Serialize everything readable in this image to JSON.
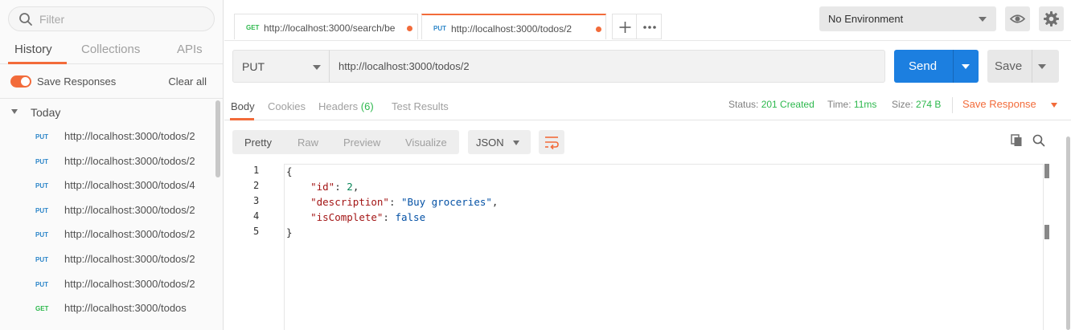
{
  "sidebar": {
    "filter_placeholder": "Filter",
    "tabs": [
      "History",
      "Collections",
      "APIs"
    ],
    "active_tab": "History",
    "save_responses_label": "Save Responses",
    "save_responses_on": true,
    "clear_all_label": "Clear all",
    "group_label": "Today",
    "history": [
      {
        "method": "PUT",
        "url": "http://localhost:3000/todos/2"
      },
      {
        "method": "PUT",
        "url": "http://localhost:3000/todos/2"
      },
      {
        "method": "PUT",
        "url": "http://localhost:3000/todos/4"
      },
      {
        "method": "PUT",
        "url": "http://localhost:3000/todos/2"
      },
      {
        "method": "PUT",
        "url": "http://localhost:3000/todos/2"
      },
      {
        "method": "PUT",
        "url": "http://localhost:3000/todos/2"
      },
      {
        "method": "PUT",
        "url": "http://localhost:3000/todos/2"
      },
      {
        "method": "GET",
        "url": "http://localhost:3000/todos"
      }
    ]
  },
  "request_tabs": [
    {
      "method": "GET",
      "url": "http://localhost:3000/search/be",
      "unsaved": true
    },
    {
      "method": "PUT",
      "url": "http://localhost:3000/todos/2",
      "unsaved": true,
      "active": true
    }
  ],
  "environment": {
    "selected": "No Environment"
  },
  "request": {
    "method": "PUT",
    "url": "http://localhost:3000/todos/2",
    "send_label": "Send",
    "save_label": "Save"
  },
  "response": {
    "tabs": {
      "body": "Body",
      "cookies": "Cookies",
      "headers": "Headers",
      "headers_count": "(6)",
      "test_results": "Test Results"
    },
    "status_label": "Status:",
    "status_value": "201 Created",
    "time_label": "Time:",
    "time_value": "11ms",
    "size_label": "Size:",
    "size_value": "274 B",
    "save_response_label": "Save Response",
    "formats": [
      "Pretty",
      "Raw",
      "Preview",
      "Visualize"
    ],
    "active_format": "Pretty",
    "language": "JSON",
    "line_numbers": [
      "1",
      "2",
      "3",
      "4",
      "5"
    ],
    "body_lines": [
      {
        "parts": [
          {
            "t": "{",
            "c": "p"
          }
        ]
      },
      {
        "parts": [
          {
            "t": "    ",
            "c": "p"
          },
          {
            "t": "\"id\"",
            "c": "k"
          },
          {
            "t": ": ",
            "c": "p"
          },
          {
            "t": "2",
            "c": "n"
          },
          {
            "t": ",",
            "c": "p"
          }
        ]
      },
      {
        "parts": [
          {
            "t": "    ",
            "c": "p"
          },
          {
            "t": "\"description\"",
            "c": "k"
          },
          {
            "t": ": ",
            "c": "p"
          },
          {
            "t": "\"Buy groceries\"",
            "c": "s"
          },
          {
            "t": ",",
            "c": "p"
          }
        ]
      },
      {
        "parts": [
          {
            "t": "    ",
            "c": "p"
          },
          {
            "t": "\"isComplete\"",
            "c": "k"
          },
          {
            "t": ": ",
            "c": "p"
          },
          {
            "t": "false",
            "c": "b"
          }
        ]
      },
      {
        "parts": [
          {
            "t": "}",
            "c": "p"
          }
        ]
      }
    ]
  },
  "colors": {
    "accent": "#f26b3a",
    "primary": "#1c7fe0",
    "put_method": "#2d86c9",
    "get_method": "#2db84d",
    "status_ok": "#2db84d"
  }
}
